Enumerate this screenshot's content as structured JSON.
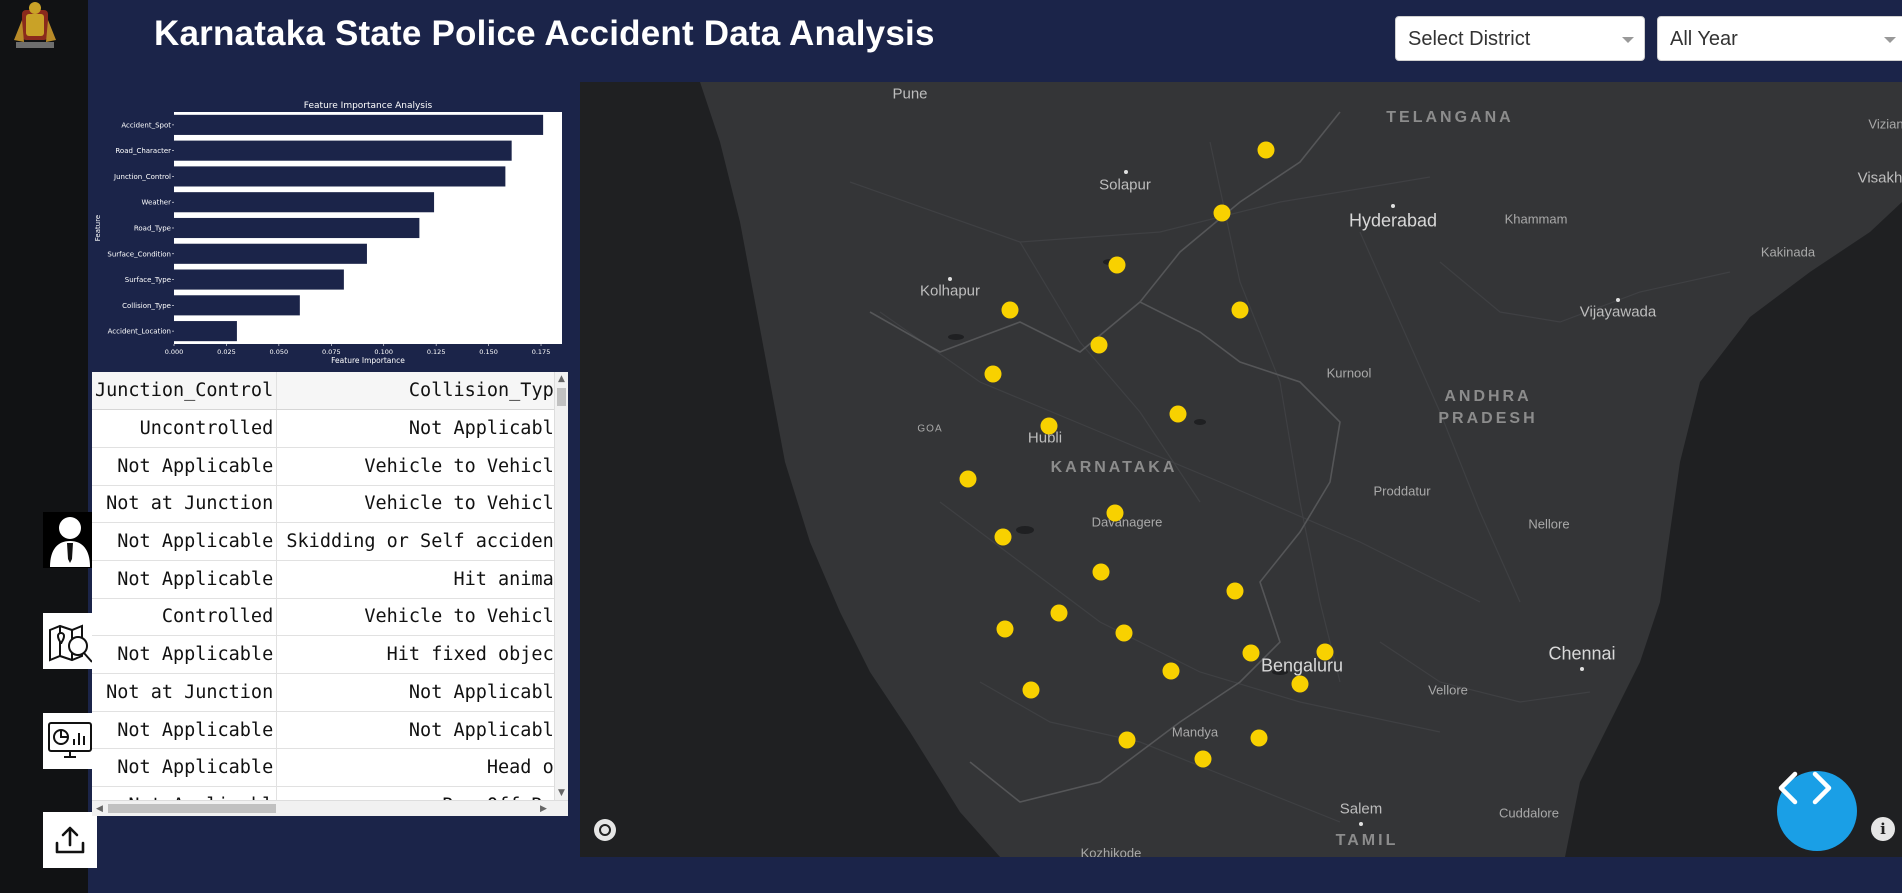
{
  "header": {
    "title": "Karnataka State Police Accident Data Analysis",
    "district_select": {
      "value": "Select District"
    },
    "year_select": {
      "value": "All Year"
    }
  },
  "sidebar": {
    "items": [
      {
        "icon": "user-icon"
      },
      {
        "icon": "map-search-icon"
      },
      {
        "icon": "dashboard-monitor-icon"
      },
      {
        "icon": "upload-icon"
      }
    ]
  },
  "chart_data": {
    "type": "bar",
    "orientation": "horizontal",
    "title": "Feature Importance Analysis",
    "xlabel": "Feature Importance",
    "ylabel": "Feature",
    "categories": [
      "Accident_Spot",
      "Road_Character",
      "Junction_Control",
      "Weather",
      "Road_Type",
      "Surface_Condition",
      "Surface_Type",
      "Collision_Type",
      "Accident_Location"
    ],
    "values": [
      0.176,
      0.161,
      0.158,
      0.124,
      0.117,
      0.092,
      0.081,
      0.06,
      0.03
    ],
    "xlim": [
      0,
      0.185
    ],
    "xticks": [
      "0.000",
      "0.025",
      "0.050",
      "0.075",
      "0.100",
      "0.125",
      "0.150",
      "0.175"
    ],
    "bar_color": "#1b2449",
    "grid": false
  },
  "table": {
    "columns": [
      "Junction_Control",
      "Collision_Typ"
    ],
    "rows": [
      [
        "Uncontrolled",
        "Not Applicabl"
      ],
      [
        "Not Applicable",
        "Vehicle to Vehicl"
      ],
      [
        "Not at Junction",
        "Vehicle to Vehicl"
      ],
      [
        "Not Applicable",
        "Skidding or Self acciden"
      ],
      [
        "Not Applicable",
        "Hit anima"
      ],
      [
        "Controlled",
        "Vehicle to Vehicl"
      ],
      [
        "Not Applicable",
        "Hit fixed objec"
      ],
      [
        "Not at Junction",
        "Not Applicabl"
      ],
      [
        "Not Applicable",
        "Not Applicabl"
      ],
      [
        "Not Applicable",
        "Head o"
      ],
      [
        "Not Applicabl",
        "Run Off Ro"
      ]
    ]
  },
  "map": {
    "accent_dot_color": "#f8d100",
    "labels": {
      "pune": "Pune",
      "telangana": "TELANGANA",
      "vizian": "Vizian",
      "visakh": "Visakh",
      "solapur": "Solapur",
      "hyderabad": "Hyderabad",
      "khammam": "Khammam",
      "kakinada": "Kakinada",
      "kolhapur": "Kolhapur",
      "vijayawada": "Vijayawada",
      "kurnool": "Kurnool",
      "andhra": "ANDHRA",
      "pradesh": "PRADESH",
      "goa": "GOA",
      "hubli": "Hubli",
      "karnataka": "KARNATAKA",
      "proddatur": "Proddatur",
      "davanagere": "Davanagere",
      "nellore": "Nellore",
      "bengaluru": "Bengaluru",
      "chennai": "Chennai",
      "vellore": "Vellore",
      "mandya": "Mandya",
      "salem": "Salem",
      "cuddalore": "Cuddalore",
      "tamil": "TAMIL",
      "kozhikode": "Kozhikode"
    }
  },
  "fab": {
    "icon": "code-icon"
  }
}
